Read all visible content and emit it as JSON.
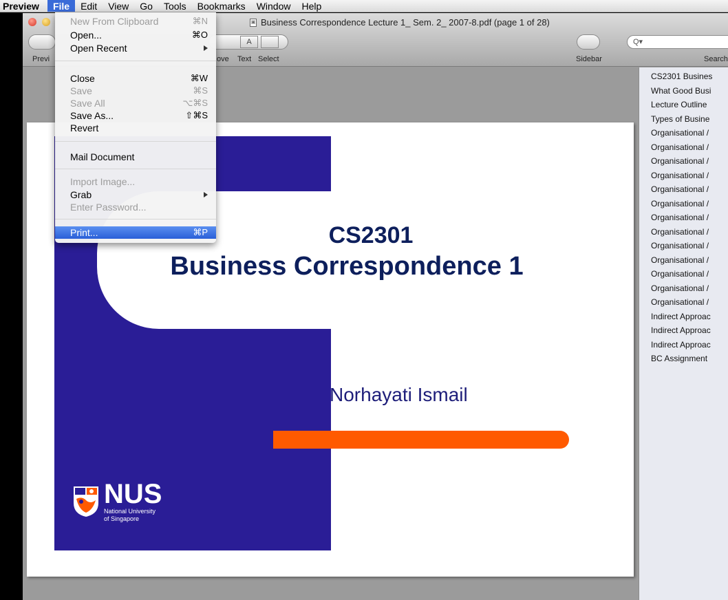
{
  "menubar": {
    "app": "Preview",
    "items": [
      "File",
      "Edit",
      "View",
      "Go",
      "Tools",
      "Bookmarks",
      "Window",
      "Help"
    ]
  },
  "window": {
    "title": "Business Correspondence Lecture 1_ Sem. 2_ 2007-8.pdf (page 1 of 28)",
    "toolbar": {
      "labels": [
        "Previ",
        "ove",
        "Text",
        "Select",
        "Sidebar",
        "Search"
      ],
      "text_button": "A",
      "search_glyph": "Q▾"
    }
  },
  "file_menu": {
    "items": [
      {
        "label": "New From Clipboard",
        "shortcut": "⌘N",
        "enabled": false
      },
      {
        "label": "Open...",
        "shortcut": "⌘O",
        "enabled": true
      },
      {
        "label": "Open Recent",
        "shortcut": "",
        "enabled": true,
        "submenu": true
      },
      {
        "label": "Close",
        "shortcut": "⌘W",
        "enabled": true
      },
      {
        "label": "Save",
        "shortcut": "⌘S",
        "enabled": false
      },
      {
        "label": "Save All",
        "shortcut": "⌥⌘S",
        "enabled": false
      },
      {
        "label": "Save As...",
        "shortcut": "⇧⌘S",
        "enabled": true
      },
      {
        "label": "Revert",
        "shortcut": "",
        "enabled": true
      },
      {
        "label": "Mail Document",
        "shortcut": "",
        "enabled": true
      },
      {
        "label": "Import Image...",
        "shortcut": "",
        "enabled": false
      },
      {
        "label": "Grab",
        "shortcut": "",
        "enabled": true,
        "submenu": true
      },
      {
        "label": "Enter Password...",
        "shortcut": "",
        "enabled": false
      },
      {
        "label": "Print...",
        "shortcut": "⌘P",
        "enabled": true,
        "highlighted": true
      }
    ]
  },
  "slide": {
    "code": "CS2301",
    "title": "Business Correspondence 1",
    "author": "Norhayati Ismail",
    "logo_text": "NUS",
    "logo_subtitle_line1": "National University",
    "logo_subtitle_line2": "of Singapore",
    "colors": {
      "blue": "#2a1d96",
      "orange": "#ff5a00",
      "title": "#0d1f5c"
    }
  },
  "sidebar": {
    "items": [
      "CS2301 Busines",
      "What Good Busi",
      "Lecture Outline",
      "Types of Busine",
      "Organisational /",
      "Organisational /",
      "Organisational /",
      "Organisational /",
      "Organisational /",
      "Organisational /",
      "Organisational /",
      "Organisational /",
      "Organisational /",
      "Organisational /",
      "Organisational /",
      "Organisational /",
      "Organisational /",
      "Indirect Approac",
      "Indirect Approac",
      "Indirect Approac",
      "BC Assignment"
    ]
  }
}
